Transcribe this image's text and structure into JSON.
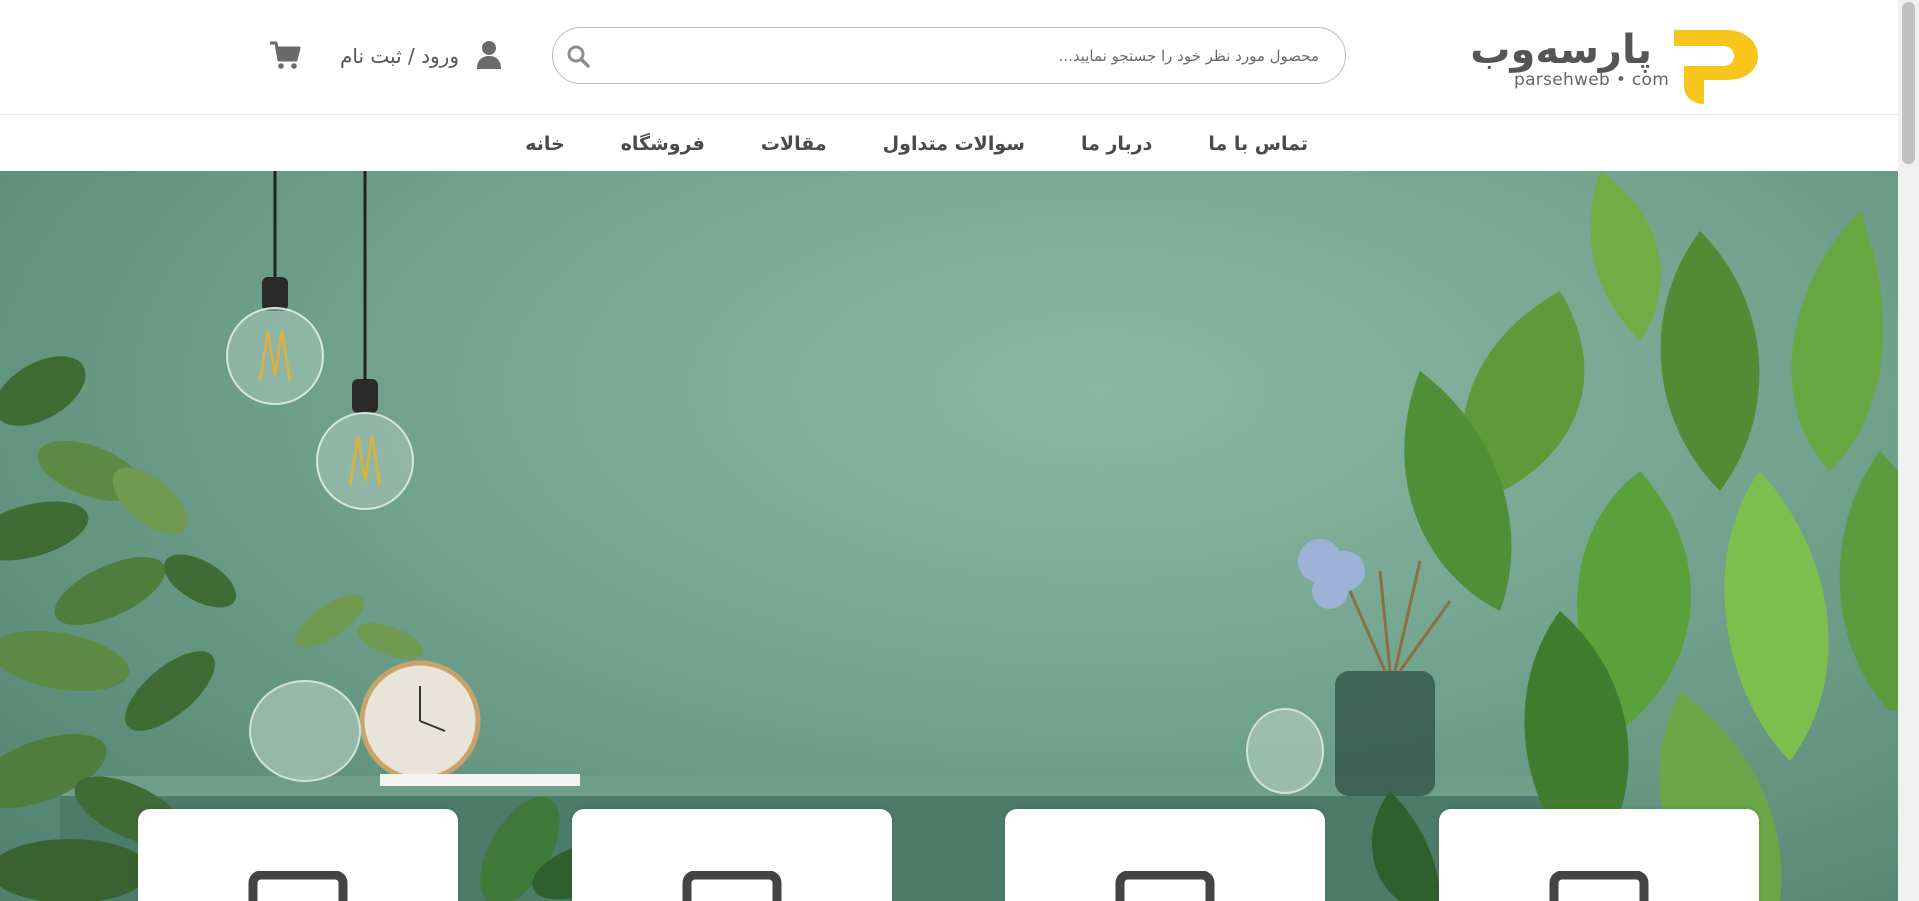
{
  "header": {
    "logo_text": "پارسه‌وب",
    "logo_domain": "parsehweb • com",
    "brand_color": "#f8c51d",
    "search": {
      "placeholder": "محصول مورد نظر خود را جستجو نمایید...",
      "value": ""
    },
    "login_label": "ورود / ثبت نام",
    "icons": {
      "search": "search-icon",
      "user": "user-icon",
      "cart": "cart-icon"
    }
  },
  "nav": {
    "items": [
      {
        "label": "خانه"
      },
      {
        "label": "فروشگاه"
      },
      {
        "label": "مقالات"
      },
      {
        "label": "سوالات متداول"
      },
      {
        "label": "دربار ما"
      },
      {
        "label": "تماس با ما"
      }
    ]
  },
  "hero": {
    "background_color": "#75a691",
    "cards": [
      {
        "icon": "card-icon"
      },
      {
        "icon": "card-icon"
      },
      {
        "icon": "card-icon"
      },
      {
        "icon": "card-icon"
      }
    ]
  }
}
